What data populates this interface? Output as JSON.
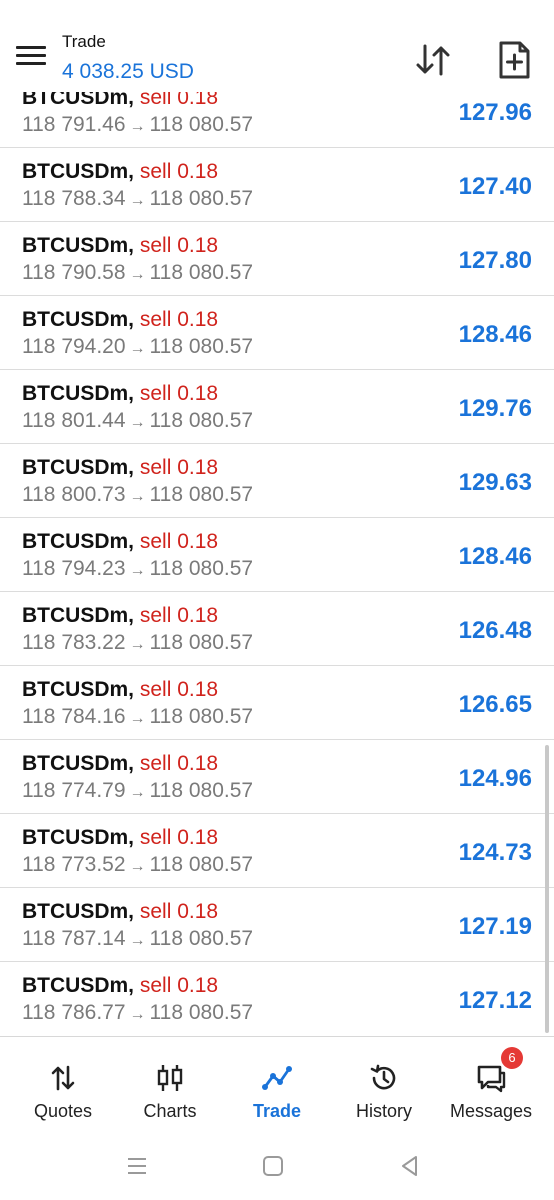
{
  "header": {
    "title": "Trade",
    "balance": "4 038.25 USD"
  },
  "positions": [
    {
      "symbol": "BTCUSDm",
      "side": "sell 0.18",
      "open_price": "118 791.46",
      "current_price": "118 080.57",
      "profit": "127.96"
    },
    {
      "symbol": "BTCUSDm",
      "side": "sell 0.18",
      "open_price": "118 788.34",
      "current_price": "118 080.57",
      "profit": "127.40"
    },
    {
      "symbol": "BTCUSDm",
      "side": "sell 0.18",
      "open_price": "118 790.58",
      "current_price": "118 080.57",
      "profit": "127.80"
    },
    {
      "symbol": "BTCUSDm",
      "side": "sell 0.18",
      "open_price": "118 794.20",
      "current_price": "118 080.57",
      "profit": "128.46"
    },
    {
      "symbol": "BTCUSDm",
      "side": "sell 0.18",
      "open_price": "118 801.44",
      "current_price": "118 080.57",
      "profit": "129.76"
    },
    {
      "symbol": "BTCUSDm",
      "side": "sell 0.18",
      "open_price": "118 800.73",
      "current_price": "118 080.57",
      "profit": "129.63"
    },
    {
      "symbol": "BTCUSDm",
      "side": "sell 0.18",
      "open_price": "118 794.23",
      "current_price": "118 080.57",
      "profit": "128.46"
    },
    {
      "symbol": "BTCUSDm",
      "side": "sell 0.18",
      "open_price": "118 783.22",
      "current_price": "118 080.57",
      "profit": "126.48"
    },
    {
      "symbol": "BTCUSDm",
      "side": "sell 0.18",
      "open_price": "118 784.16",
      "current_price": "118 080.57",
      "profit": "126.65"
    },
    {
      "symbol": "BTCUSDm",
      "side": "sell 0.18",
      "open_price": "118 774.79",
      "current_price": "118 080.57",
      "profit": "124.96"
    },
    {
      "symbol": "BTCUSDm",
      "side": "sell 0.18",
      "open_price": "118 773.52",
      "current_price": "118 080.57",
      "profit": "124.73"
    },
    {
      "symbol": "BTCUSDm",
      "side": "sell 0.18",
      "open_price": "118 787.14",
      "current_price": "118 080.57",
      "profit": "127.19"
    },
    {
      "symbol": "BTCUSDm",
      "side": "sell 0.18",
      "open_price": "118 786.77",
      "current_price": "118 080.57",
      "profit": "127.12"
    }
  ],
  "tabs": [
    {
      "label": "Quotes",
      "icon": "quotes-arrows-icon"
    },
    {
      "label": "Charts",
      "icon": "candlestick-icon"
    },
    {
      "label": "Trade",
      "icon": "trade-line-icon",
      "active": true
    },
    {
      "label": "History",
      "icon": "history-clock-icon"
    },
    {
      "label": "Messages",
      "icon": "messages-icon",
      "badge": "6"
    }
  ],
  "colors": {
    "accent": "#1a73d9",
    "sell": "#d0231c",
    "badge": "#e53935"
  }
}
